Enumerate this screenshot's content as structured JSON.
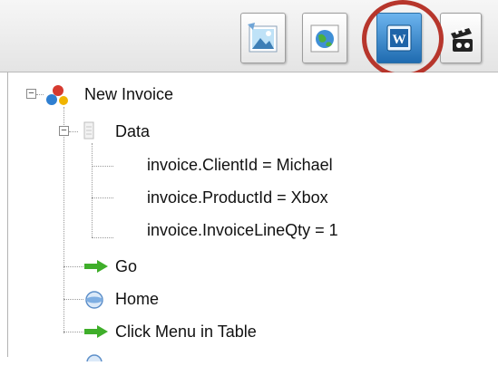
{
  "toolbar": {
    "buttons": [
      {
        "icon": "picture-icon"
      },
      {
        "icon": "globe-icon"
      },
      {
        "icon": "word-document-icon"
      },
      {
        "icon": "film-reel-icon"
      }
    ],
    "highlight_color": "#b7362c"
  },
  "tree": {
    "root": {
      "label": "New Invoice",
      "expander": "−"
    },
    "data": {
      "label": "Data",
      "expander": "−"
    },
    "data_items": [
      {
        "label": "invoice.ClientId = Michael"
      },
      {
        "label": "invoice.ProductId = Xbox"
      },
      {
        "label": "invoice.InvoiceLineQty = 1"
      }
    ],
    "steps": [
      {
        "label": "Go",
        "icon": "green-arrow-icon"
      },
      {
        "label": "Home",
        "icon": "home-globe-icon"
      },
      {
        "label": "Click Menu in Table",
        "icon": "green-arrow-icon"
      }
    ]
  },
  "colors": {
    "arrow_green": "#3fae2a",
    "word_blue": "#2f7fc1"
  }
}
